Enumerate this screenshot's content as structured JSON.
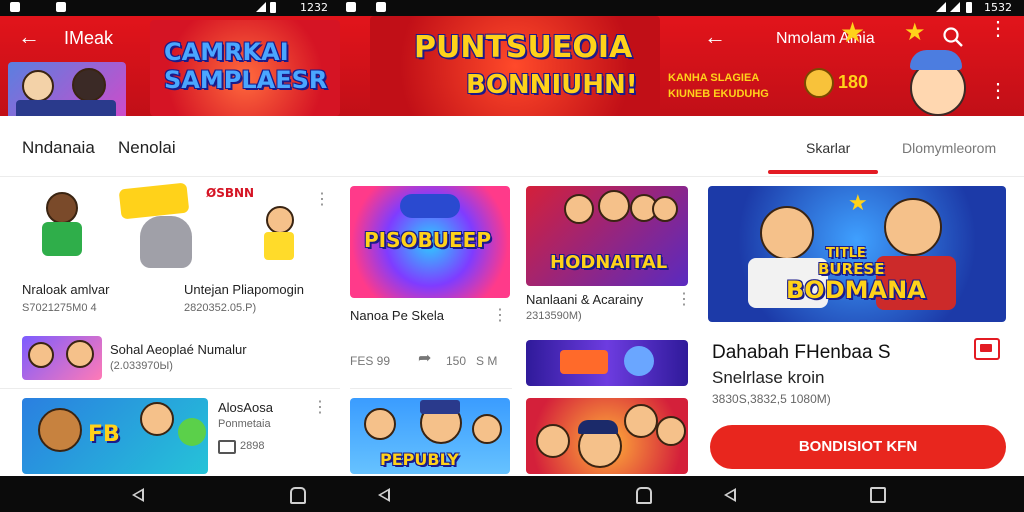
{
  "status_bar": {
    "time_left": "1232",
    "time_right": "1532"
  },
  "header": {
    "left_title": "IMeak",
    "right_title": "Nmolam Alnia",
    "banner_left_logo": "CAMRKAI SAMPLAESR",
    "banner_center_line1": "PUNTSUEOIA",
    "banner_center_line2": "BONNIUHN!",
    "banner_right_text_line1": "KANHA SLAGIEA",
    "banner_right_text_line2": "KIUNEB EKUDUHG",
    "banner_right_number": "180"
  },
  "tabs": {
    "left_tab_1": "Nndanaia",
    "left_tab_2": "Nenolai",
    "right_tab_active": "Skarlar",
    "right_tab_2": "Dlomymleorom"
  },
  "col1": {
    "card1": {
      "title_a": "Nraloak amlvar",
      "title_b": "Untejan Pliapomogin",
      "sub": "S7021275M0 4",
      "sub_b": "2820352.05.P)",
      "badge": "ØSBNN"
    },
    "card2": {
      "title": "Sohal Aeoplaé Numalur",
      "sub": "(2.033970Ы)"
    },
    "card3": {
      "title": "AlosAosa",
      "sub": "Ponmetaia",
      "meta": "2898",
      "tag": "FB"
    }
  },
  "col2": {
    "card1": {
      "title": "Nanoa Pe Skela",
      "logo": "PISOBUEEP"
    },
    "stats": {
      "a": "FES 99",
      "b": "150",
      "c": "S M"
    },
    "card2": {
      "logo": "PEPUBLY"
    }
  },
  "col3": {
    "card1": {
      "title": "Nanlaani & Acarainy",
      "sub": "2313590M)",
      "logo": "HODNAITAL"
    }
  },
  "col4": {
    "feature": {
      "logo_line1": "TITLE",
      "logo_line2": "BURESE",
      "logo_line3": "BODMANA"
    },
    "title": "Dahabah FHenbaa S",
    "subtitle": "Snelrlase kroin",
    "meta": "3830S,3832,5 1080M)",
    "cta_label": "BONDISIOT KFN"
  },
  "colors": {
    "brand_red": "#e2141b",
    "cta_red": "#e8261e",
    "accent_yellow": "#ffd21a"
  }
}
